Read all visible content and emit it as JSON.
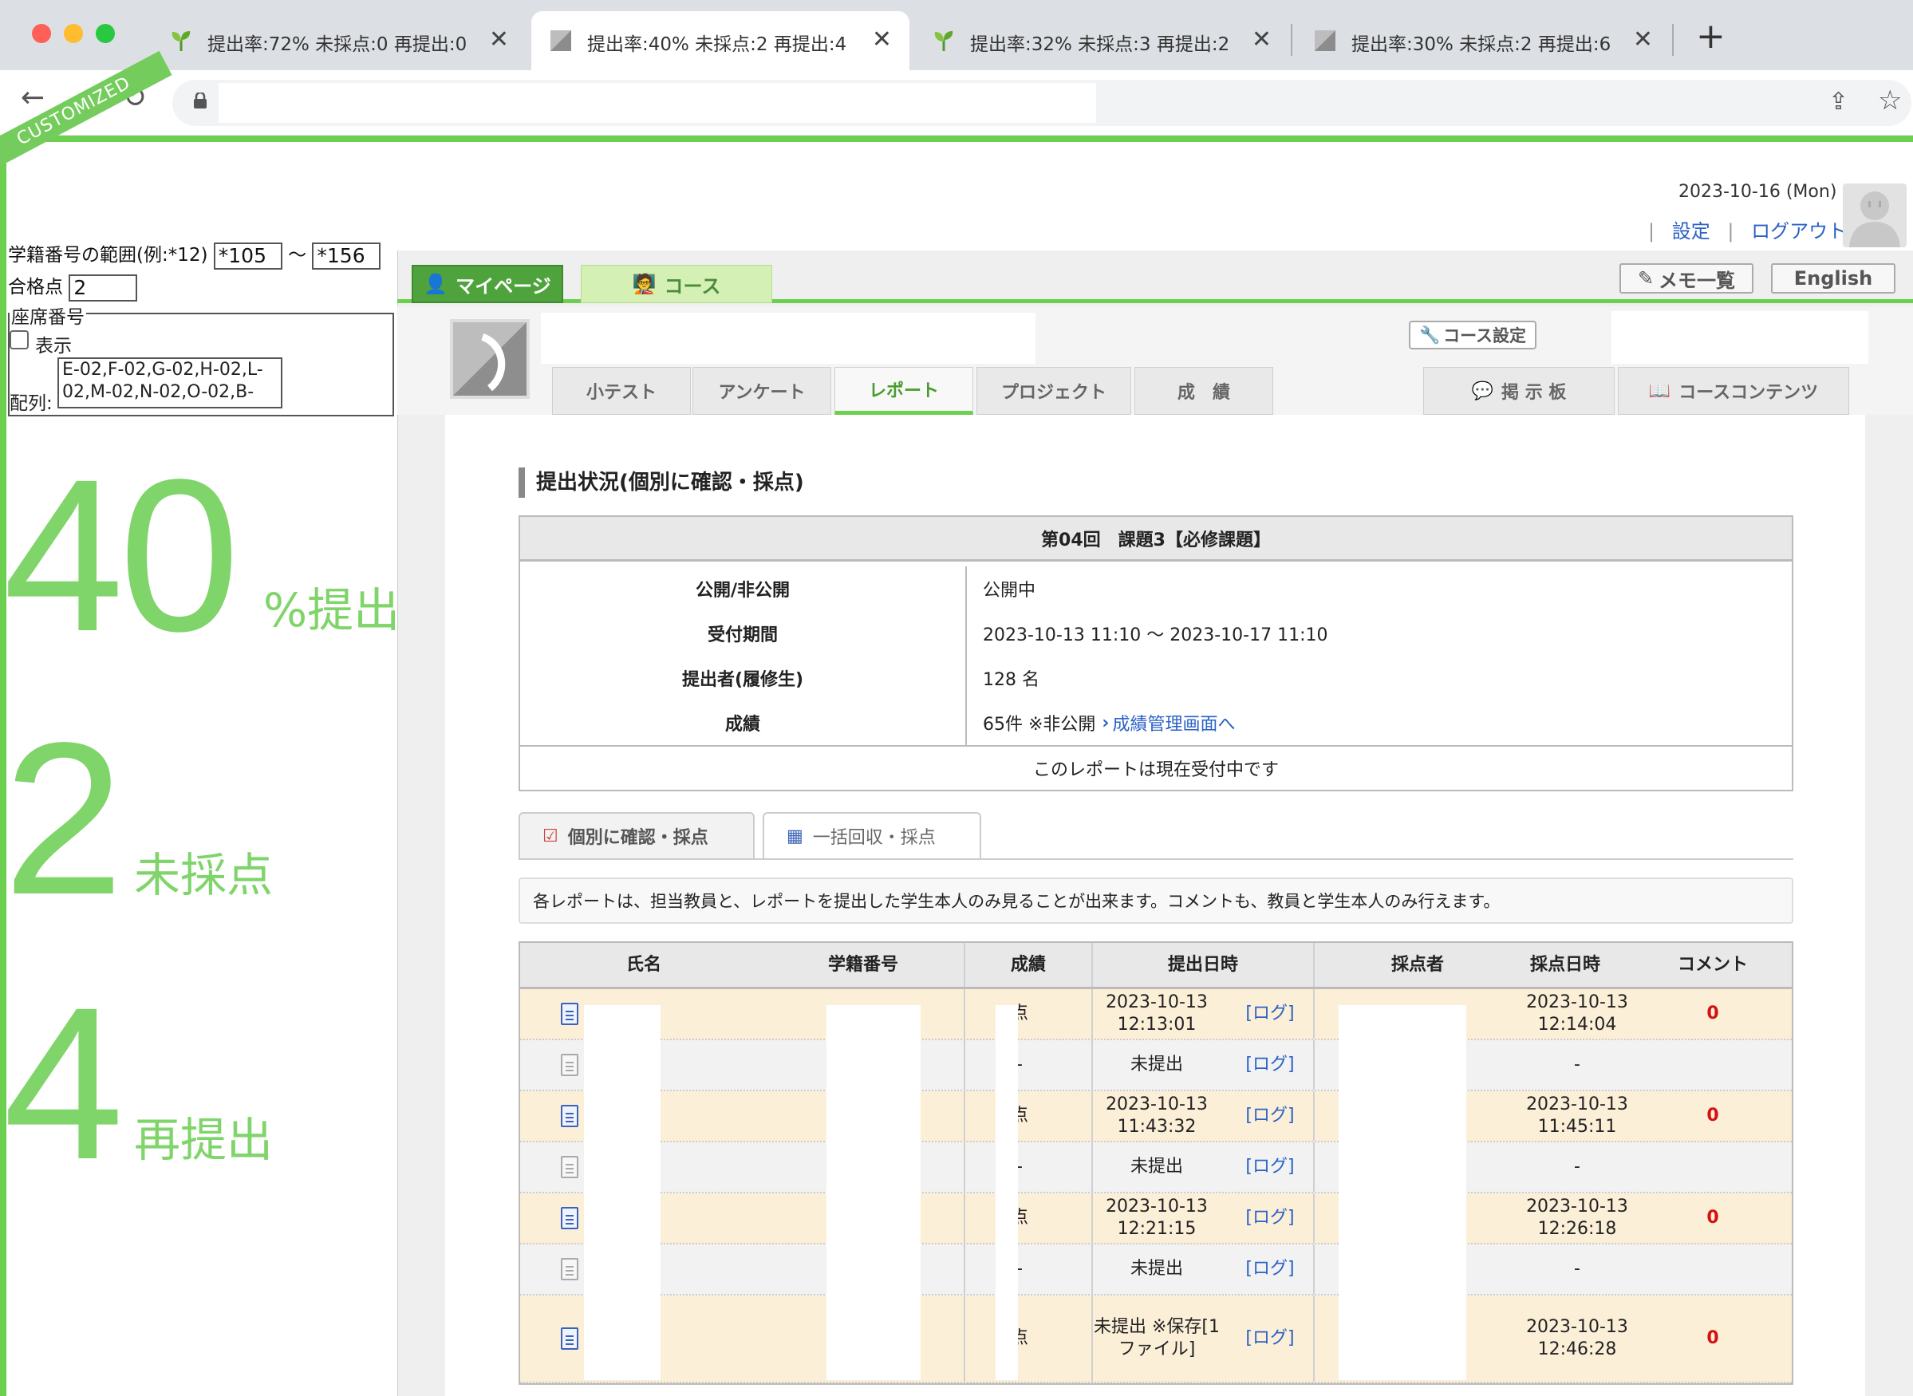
{
  "browser": {
    "tabs": [
      {
        "title": "提出率:72% 未採点:0 再提出:0"
      },
      {
        "title": "提出率:40% 未採点:2 再提出:4"
      },
      {
        "title": "提出率:32% 未採点:3 再提出:2"
      },
      {
        "title": "提出率:30% 未採点:2 再提出:6"
      }
    ],
    "close_glyph": "✕",
    "new_tab_glyph": "+"
  },
  "customized": {
    "ribbon": "CUSTOMIZED",
    "range_label": "学籍番号の範囲(例:*12)",
    "range_from": "*105",
    "range_sep": "〜",
    "range_to": "*156",
    "pass_label": "合格点",
    "pass_value": "2",
    "seat_legend": "座席番号",
    "show_label": "表示",
    "array_label": "配列:",
    "array_value": "E-02,F-02,G-02,H-02,L-02,M-02,N-02,O-02,B-",
    "rate_value": "40",
    "rate_label": "%提出",
    "ungraded_value": "2",
    "ungraded_label": "未採点",
    "resubmit_value": "4",
    "resubmit_label": "再提出"
  },
  "header": {
    "date": "2023-10-16 (Mon)",
    "settings": "設定",
    "logout": "ログアウト",
    "sep": "|"
  },
  "main_nav": {
    "mypage": "マイページ",
    "course": "コース",
    "memo": "メモ一覧",
    "english": "English"
  },
  "course": {
    "setting": "コース設定",
    "subtabs": [
      "小テスト",
      "アンケート",
      "レポート",
      "プロジェクト",
      "成　績"
    ],
    "board": "掲 示 板",
    "contents": "コースコンテンツ"
  },
  "report": {
    "section_title": "提出状況(個別に確認・採点)",
    "heading": "第04回　課題3【必修課題】",
    "rows": [
      {
        "k": "公開/非公開",
        "v": "公開中"
      },
      {
        "k": "受付期間",
        "v": "2023-10-13 11:10 〜 2023-10-17 11:10"
      },
      {
        "k": "提出者(履修生)",
        "v": "128 名"
      }
    ],
    "grade_key": "成績",
    "grade_text": "65件 ※非公開",
    "grade_link": "成績管理画面へ",
    "status": "このレポートは現在受付中です",
    "tab_individual": "個別に確認・採点",
    "tab_bulk": "一括回収・採点",
    "notice": "各レポートは、担当教員と、レポートを提出した学生本人のみ見ることが出来ます。コメントも、教員と学生本人のみ行えます。"
  },
  "list": {
    "headers": {
      "name": "氏名",
      "student_id": "学籍番号",
      "grade": "成績",
      "submitted": "提出日時",
      "grader": "採点者",
      "graded": "採点日時",
      "comment": "コメント"
    },
    "log_label": "[ログ]",
    "rows": [
      {
        "kind": "sub",
        "grade": "点",
        "submitted": "2023-10-13 12:13:01",
        "graded": "2023-10-13 12:14:04",
        "comment": "0"
      },
      {
        "kind": "none",
        "grade": "-",
        "submitted": "未提出",
        "graded": "-",
        "comment": ""
      },
      {
        "kind": "sub",
        "grade": "点",
        "submitted": "2023-10-13 11:43:32",
        "graded": "2023-10-13 11:45:11",
        "comment": "0"
      },
      {
        "kind": "none",
        "grade": "-",
        "submitted": "未提出",
        "graded": "-",
        "comment": ""
      },
      {
        "kind": "sub",
        "grade": "点",
        "submitted": "2023-10-13 12:21:15",
        "graded": "2023-10-13 12:26:18",
        "comment": "0"
      },
      {
        "kind": "none",
        "grade": "-",
        "submitted": "未提出",
        "graded": "-",
        "comment": ""
      },
      {
        "kind": "saved",
        "grade": "点",
        "submitted": "未提出 ※保存[1ファイル]",
        "graded": "2023-10-13 12:46:28",
        "comment": "0"
      }
    ]
  }
}
